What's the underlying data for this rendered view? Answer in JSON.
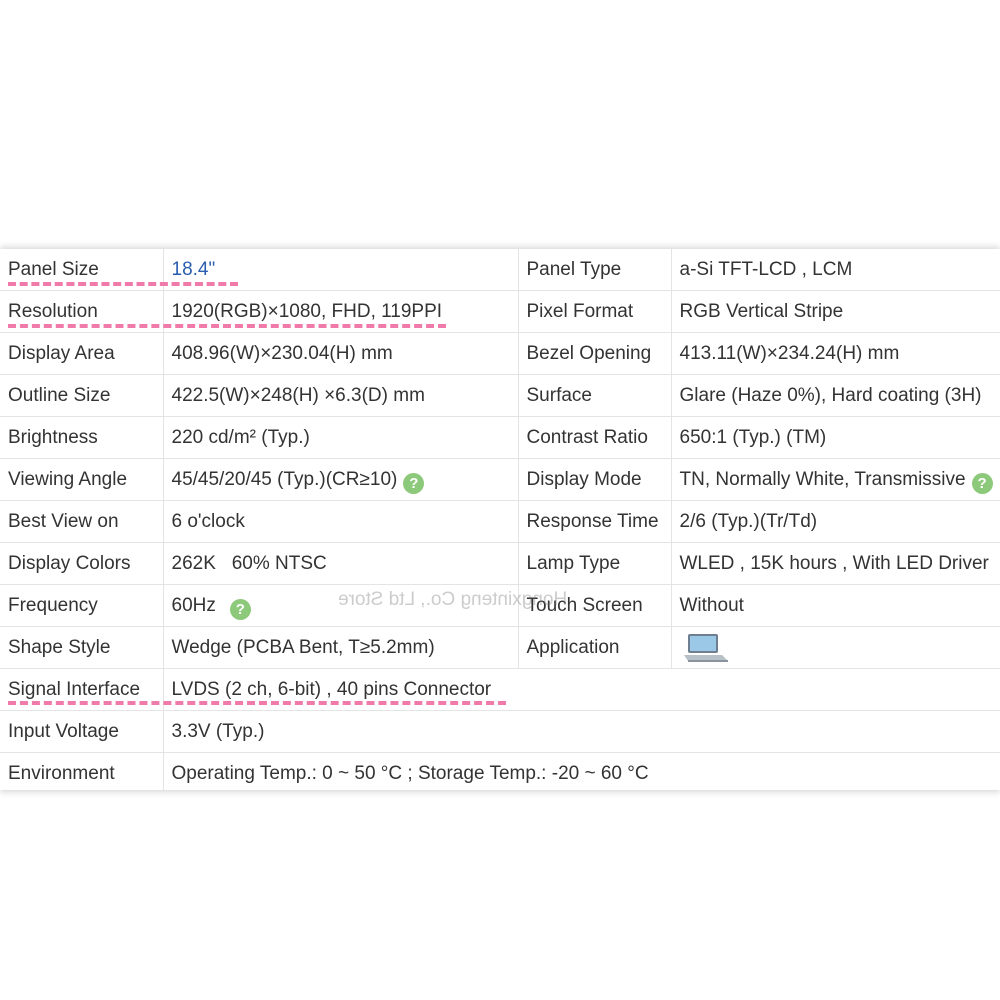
{
  "accent_color": "#f07aa9",
  "link_color": "#2a5db0",
  "help_icon_color": "#8dc97a",
  "watermark": "Hongxinteng Co., Ltd Store",
  "rows": [
    {
      "l1": "Panel Size",
      "v1": "18.4\"",
      "l2": "Panel Type",
      "v2": "a-Si TFT-LCD , LCM"
    },
    {
      "l1": "Resolution",
      "v1": "1920(RGB)×1080, FHD, 119PPI",
      "l2": "Pixel Format",
      "v2": "RGB Vertical Stripe"
    },
    {
      "l1": "Display Area",
      "v1": "408.96(W)×230.04(H) mm",
      "l2": "Bezel Opening",
      "v2": "413.11(W)×234.24(H) mm"
    },
    {
      "l1": "Outline Size",
      "v1": "422.5(W)×248(H) ×6.3(D) mm",
      "l2": "Surface",
      "v2": "Glare (Haze 0%), Hard coating (3H)"
    },
    {
      "l1": "Brightness",
      "v1": "220 cd/m² (Typ.)",
      "l2": "Contrast Ratio",
      "v2": "650:1 (Typ.) (TM)"
    },
    {
      "l1": "Viewing Angle",
      "v1": "45/45/20/45 (Typ.)(CR≥10)",
      "l2": "Display Mode",
      "v2": "TN, Normally White, Transmissive"
    },
    {
      "l1": "Best View on",
      "v1": "6 o'clock",
      "l2": "Response Time",
      "v2": "2/6 (Typ.)(Tr/Td)"
    },
    {
      "l1": "Display Colors",
      "v1": "262K   60% NTSC",
      "l2": "Lamp Type",
      "v2": "WLED , 15K hours , With LED Driver"
    },
    {
      "l1": "Frequency",
      "v1": "60Hz",
      "l2": "Touch Screen",
      "v2": "Without"
    },
    {
      "l1": "Shape Style",
      "v1": "Wedge (PCBA Bent, T≥5.2mm)",
      "l2": "Application",
      "v2": "laptop-icon"
    },
    {
      "l1": "Signal Interface",
      "v1": "LVDS (2 ch, 6-bit) , 40 pins Connector"
    },
    {
      "l1": "Input Voltage",
      "v1": "3.3V (Typ.)"
    },
    {
      "l1": "Environment",
      "v1": "Operating Temp.: 0 ~ 50 °C ; Storage Temp.: -20 ~ 60 °C"
    }
  ],
  "help_icon_glyph": "?"
}
